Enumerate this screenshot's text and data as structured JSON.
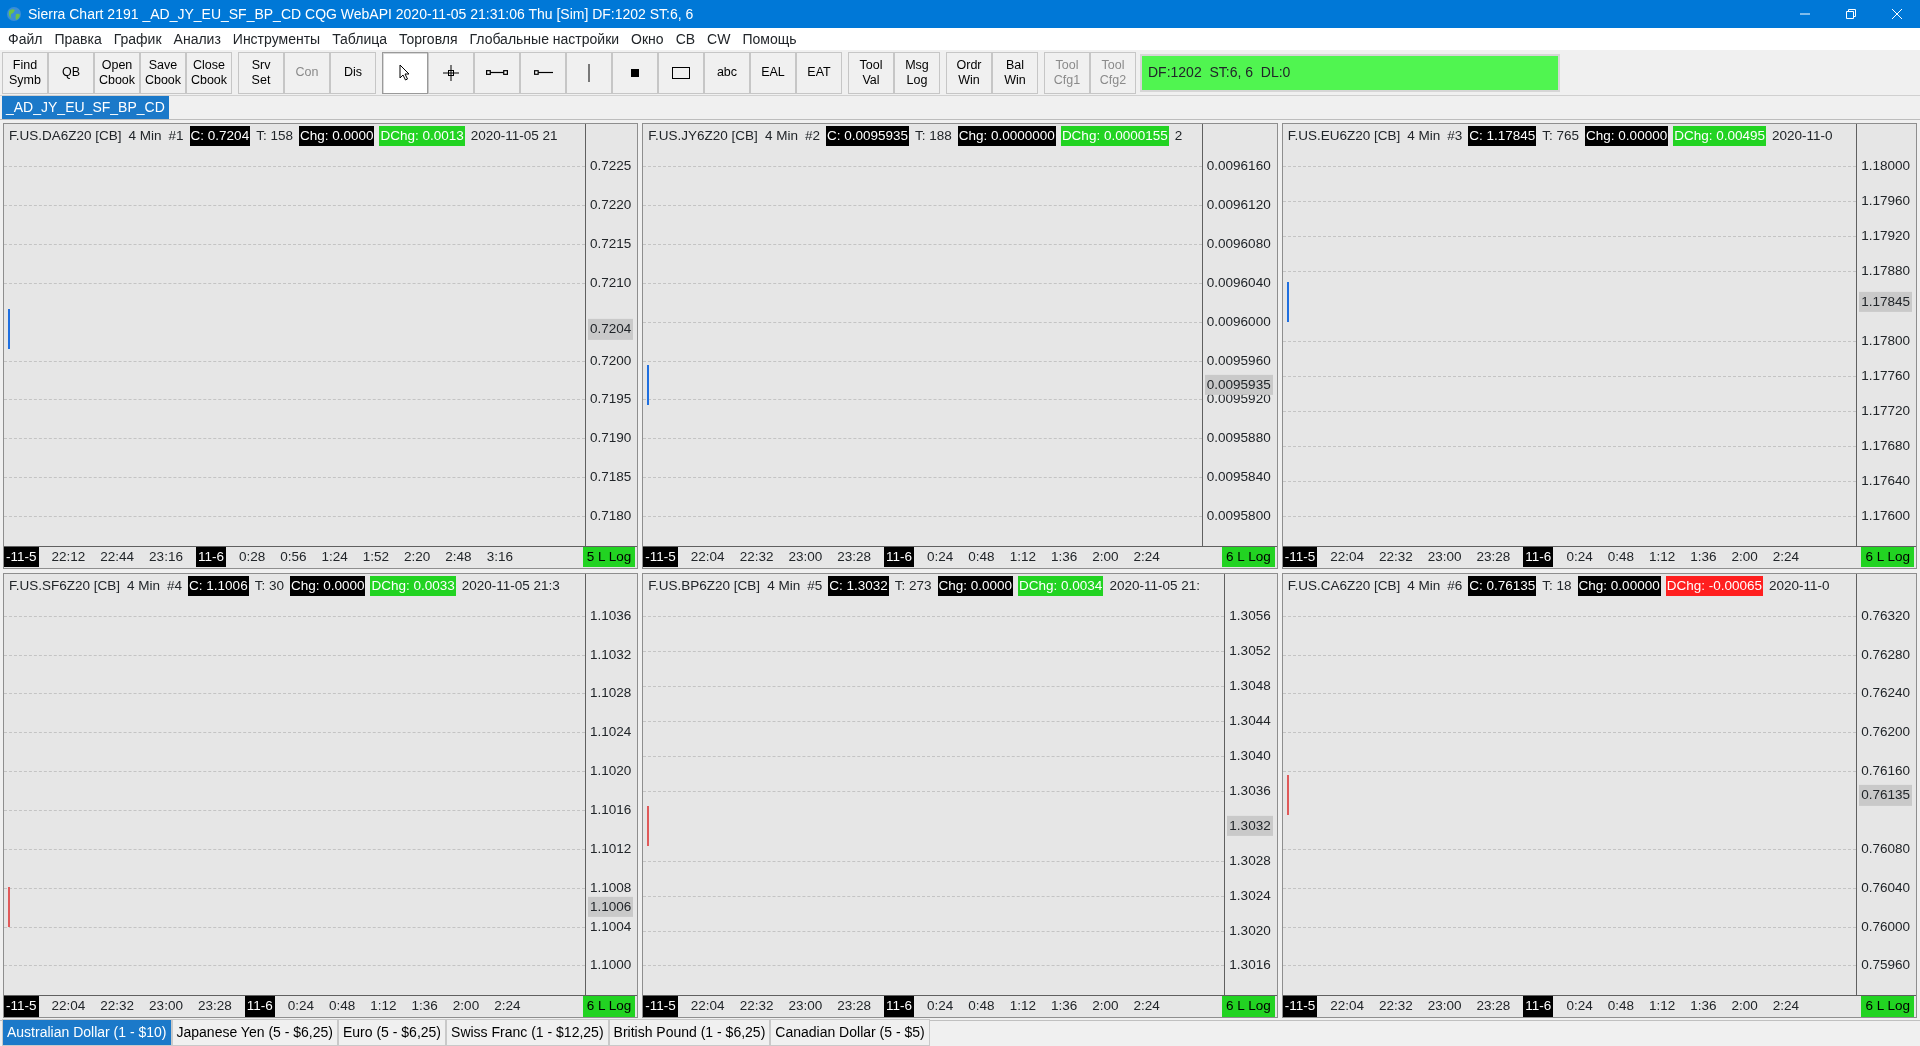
{
  "window": {
    "title": "Sierra Chart 2191 _AD_JY_EU_SF_BP_CD  CQG WebAPI 2020-11-05  21:31:06 Thu [Sim]  DF:1202  ST:6, 6"
  },
  "menu": [
    "Файл",
    "Правка",
    "График",
    "Анализ",
    "Инструменты",
    "Таблица",
    "Торговля",
    "Глобальные настройки",
    "Окно",
    "CB",
    "CW",
    "Помощь"
  ],
  "toolbar": [
    {
      "kind": "text",
      "lines": [
        "Find",
        "Symb"
      ],
      "disabled": false
    },
    {
      "kind": "text",
      "lines": [
        "QB"
      ],
      "disabled": false
    },
    {
      "kind": "text",
      "lines": [
        "Open",
        "Cbook"
      ],
      "disabled": false
    },
    {
      "kind": "text",
      "lines": [
        "Save",
        "Cbook"
      ],
      "disabled": false
    },
    {
      "kind": "text",
      "lines": [
        "Close",
        "Cbook"
      ],
      "disabled": false
    },
    {
      "kind": "text",
      "lines": [
        "Srv",
        "Set"
      ],
      "disabled": false,
      "group_start": true
    },
    {
      "kind": "text",
      "lines": [
        "Con"
      ],
      "disabled": true
    },
    {
      "kind": "text",
      "lines": [
        "Dis"
      ],
      "disabled": false
    },
    {
      "kind": "tool",
      "selected": true,
      "group_start": true
    },
    {
      "kind": "tool",
      "selected": false
    },
    {
      "kind": "tool",
      "selected": false
    },
    {
      "kind": "tool",
      "selected": false
    },
    {
      "kind": "tool",
      "selected": false
    },
    {
      "kind": "tool",
      "selected": false
    },
    {
      "kind": "tool",
      "selected": false
    },
    {
      "kind": "text",
      "lines": [
        "abc"
      ],
      "disabled": false
    },
    {
      "kind": "text",
      "lines": [
        "EAL"
      ],
      "disabled": false
    },
    {
      "kind": "text",
      "lines": [
        "EAT"
      ],
      "disabled": false
    },
    {
      "kind": "text",
      "lines": [
        "Tool",
        "Val"
      ],
      "disabled": false,
      "group_start": true
    },
    {
      "kind": "text",
      "lines": [
        "Msg",
        "Log"
      ],
      "disabled": false
    },
    {
      "kind": "text",
      "lines": [
        "Ordr",
        "Win"
      ],
      "disabled": false,
      "group_start": true
    },
    {
      "kind": "text",
      "lines": [
        "Bal",
        "Win"
      ],
      "disabled": false
    },
    {
      "kind": "text",
      "lines": [
        "Tool",
        "Cfg1"
      ],
      "disabled": true,
      "group_start": true
    },
    {
      "kind": "text",
      "lines": [
        "Tool",
        "Cfg2"
      ],
      "disabled": true
    }
  ],
  "status": "DF:1202  ST:6, 6  DL:0",
  "chartbook_tabs": [
    {
      "label": "_AD_JY_EU_SF_BP_CD",
      "selected": true
    }
  ],
  "charts": [
    {
      "color": "#1f6fe0",
      "header": [
        {
          "kind": "text",
          "text": "F.US.DA6Z20 [CB]"
        },
        {
          "kind": "text",
          "text": "4 Min"
        },
        {
          "kind": "text",
          "text": "#1"
        },
        {
          "kind": "dark",
          "text": "C: 0.7204"
        },
        {
          "kind": "text",
          "text": "T: 158"
        },
        {
          "kind": "dark",
          "text": "Chg: 0.0000"
        },
        {
          "kind": "green",
          "text": "DChg: 0.0013"
        },
        {
          "kind": "text",
          "text": "2020-11-05 21"
        }
      ],
      "price_labels": [
        "0.7225",
        "0.7220",
        "0.7215",
        "0.7210",
        "0.7200",
        "0.7195",
        "0.7190",
        "0.7185",
        "0.7180"
      ],
      "current_price": "0.7204",
      "time_labels": [
        {
          "kind": "date",
          "text": "-11-5"
        },
        {
          "kind": "time",
          "text": "22:12"
        },
        {
          "kind": "time",
          "text": "22:44"
        },
        {
          "kind": "time",
          "text": "23:16"
        },
        {
          "kind": "date",
          "text": "11-6"
        },
        {
          "kind": "time",
          "text": "0:28"
        },
        {
          "kind": "time",
          "text": "0:56"
        },
        {
          "kind": "time",
          "text": "1:24"
        },
        {
          "kind": "time",
          "text": "1:52"
        },
        {
          "kind": "time",
          "text": "2:20"
        },
        {
          "kind": "time",
          "text": "2:48"
        },
        {
          "kind": "time",
          "text": "3:16"
        }
      ],
      "scale": "5 L Log"
    },
    {
      "color": "#1f6fe0",
      "header": [
        {
          "kind": "text",
          "text": "F.US.JY6Z20 [CB]"
        },
        {
          "kind": "text",
          "text": "4 Min"
        },
        {
          "kind": "text",
          "text": "#2"
        },
        {
          "kind": "dark",
          "text": "C: 0.0095935"
        },
        {
          "kind": "text",
          "text": "T: 188"
        },
        {
          "kind": "dark",
          "text": "Chg: 0.0000000"
        },
        {
          "kind": "green",
          "text": "DChg: 0.0000155"
        },
        {
          "kind": "text",
          "text": "2"
        }
      ],
      "price_labels": [
        "0.0096160",
        "0.0096120",
        "0.0096080",
        "0.0096040",
        "0.0096000",
        "0.0095960",
        "0.0095920",
        "0.0095880",
        "0.0095840",
        "0.0095800"
      ],
      "current_price": "0.0095935",
      "time_labels": [
        {
          "kind": "date",
          "text": "-11-5"
        },
        {
          "kind": "time",
          "text": "22:04"
        },
        {
          "kind": "time",
          "text": "22:32"
        },
        {
          "kind": "time",
          "text": "23:00"
        },
        {
          "kind": "time",
          "text": "23:28"
        },
        {
          "kind": "date",
          "text": "11-6"
        },
        {
          "kind": "time",
          "text": "0:24"
        },
        {
          "kind": "time",
          "text": "0:48"
        },
        {
          "kind": "time",
          "text": "1:12"
        },
        {
          "kind": "time",
          "text": "1:36"
        },
        {
          "kind": "time",
          "text": "2:00"
        },
        {
          "kind": "time",
          "text": "2:24"
        }
      ],
      "scale": "6 L Log"
    },
    {
      "color": "#1f6fe0",
      "header": [
        {
          "kind": "text",
          "text": "F.US.EU6Z20 [CB]"
        },
        {
          "kind": "text",
          "text": "4 Min"
        },
        {
          "kind": "text",
          "text": "#3"
        },
        {
          "kind": "dark",
          "text": "C: 1.17845"
        },
        {
          "kind": "text",
          "text": "T: 765"
        },
        {
          "kind": "dark",
          "text": "Chg: 0.00000"
        },
        {
          "kind": "green",
          "text": "DChg: 0.00495"
        },
        {
          "kind": "text",
          "text": "2020-11-0"
        }
      ],
      "price_labels": [
        "1.18000",
        "1.17960",
        "1.17920",
        "1.17880",
        "1.17800",
        "1.17760",
        "1.17720",
        "1.17680",
        "1.17640",
        "1.17600"
      ],
      "current_price": "1.17845",
      "time_labels": [
        {
          "kind": "date",
          "text": "-11-5"
        },
        {
          "kind": "time",
          "text": "22:04"
        },
        {
          "kind": "time",
          "text": "22:32"
        },
        {
          "kind": "time",
          "text": "23:00"
        },
        {
          "kind": "time",
          "text": "23:28"
        },
        {
          "kind": "date",
          "text": "11-6"
        },
        {
          "kind": "time",
          "text": "0:24"
        },
        {
          "kind": "time",
          "text": "0:48"
        },
        {
          "kind": "time",
          "text": "1:12"
        },
        {
          "kind": "time",
          "text": "1:36"
        },
        {
          "kind": "time",
          "text": "2:00"
        },
        {
          "kind": "time",
          "text": "2:24"
        }
      ],
      "scale": "6 L Log"
    },
    {
      "color": "#e05a5a",
      "header": [
        {
          "kind": "text",
          "text": "F.US.SF6Z20 [CB]"
        },
        {
          "kind": "text",
          "text": "4 Min"
        },
        {
          "kind": "text",
          "text": "#4"
        },
        {
          "kind": "dark",
          "text": "C: 1.1006"
        },
        {
          "kind": "text",
          "text": "T: 30"
        },
        {
          "kind": "dark",
          "text": "Chg: 0.0000"
        },
        {
          "kind": "green",
          "text": "DChg: 0.0033"
        },
        {
          "kind": "text",
          "text": "2020-11-05 21:3"
        }
      ],
      "price_labels": [
        "1.1036",
        "1.1032",
        "1.1028",
        "1.1024",
        "1.1020",
        "1.1016",
        "1.1012",
        "1.1008",
        "1.1004",
        "1.1000"
      ],
      "current_price": "1.1006",
      "time_labels": [
        {
          "kind": "date",
          "text": "-11-5"
        },
        {
          "kind": "time",
          "text": "22:04"
        },
        {
          "kind": "time",
          "text": "22:32"
        },
        {
          "kind": "time",
          "text": "23:00"
        },
        {
          "kind": "time",
          "text": "23:28"
        },
        {
          "kind": "date",
          "text": "11-6"
        },
        {
          "kind": "time",
          "text": "0:24"
        },
        {
          "kind": "time",
          "text": "0:48"
        },
        {
          "kind": "time",
          "text": "1:12"
        },
        {
          "kind": "time",
          "text": "1:36"
        },
        {
          "kind": "time",
          "text": "2:00"
        },
        {
          "kind": "time",
          "text": "2:24"
        }
      ],
      "scale": "6 L Log"
    },
    {
      "color": "#e05a5a",
      "header": [
        {
          "kind": "text",
          "text": "F.US.BP6Z20 [CB]"
        },
        {
          "kind": "text",
          "text": "4 Min"
        },
        {
          "kind": "text",
          "text": "#5"
        },
        {
          "kind": "dark",
          "text": "C: 1.3032"
        },
        {
          "kind": "text",
          "text": "T: 273"
        },
        {
          "kind": "dark",
          "text": "Chg: 0.0000"
        },
        {
          "kind": "green",
          "text": "DChg: 0.0034"
        },
        {
          "kind": "text",
          "text": "2020-11-05 21:"
        }
      ],
      "price_labels": [
        "1.3056",
        "1.3052",
        "1.3048",
        "1.3044",
        "1.3040",
        "1.3036",
        "1.3028",
        "1.3024",
        "1.3020",
        "1.3016"
      ],
      "current_price": "1.3032",
      "time_labels": [
        {
          "kind": "date",
          "text": "-11-5"
        },
        {
          "kind": "time",
          "text": "22:04"
        },
        {
          "kind": "time",
          "text": "22:32"
        },
        {
          "kind": "time",
          "text": "23:00"
        },
        {
          "kind": "time",
          "text": "23:28"
        },
        {
          "kind": "date",
          "text": "11-6"
        },
        {
          "kind": "time",
          "text": "0:24"
        },
        {
          "kind": "time",
          "text": "0:48"
        },
        {
          "kind": "time",
          "text": "1:12"
        },
        {
          "kind": "time",
          "text": "1:36"
        },
        {
          "kind": "time",
          "text": "2:00"
        },
        {
          "kind": "time",
          "text": "2:24"
        }
      ],
      "scale": "6 L Log"
    },
    {
      "color": "#e05a5a",
      "header": [
        {
          "kind": "text",
          "text": "F.US.CA6Z20 [CB]"
        },
        {
          "kind": "text",
          "text": "4 Min"
        },
        {
          "kind": "text",
          "text": "#6"
        },
        {
          "kind": "dark",
          "text": "C: 0.76135"
        },
        {
          "kind": "text",
          "text": "T: 18"
        },
        {
          "kind": "dark",
          "text": "Chg: 0.00000"
        },
        {
          "kind": "red",
          "text": "DChg: -0.00065"
        },
        {
          "kind": "text",
          "text": "2020-11-0"
        }
      ],
      "price_labels": [
        "0.76320",
        "0.76280",
        "0.76240",
        "0.76200",
        "0.76160",
        "0.76080",
        "0.76040",
        "0.76000",
        "0.75960"
      ],
      "current_price": "0.76135",
      "time_labels": [
        {
          "kind": "date",
          "text": "-11-5"
        },
        {
          "kind": "time",
          "text": "22:04"
        },
        {
          "kind": "time",
          "text": "22:32"
        },
        {
          "kind": "time",
          "text": "23:00"
        },
        {
          "kind": "time",
          "text": "23:28"
        },
        {
          "kind": "date",
          "text": "11-6"
        },
        {
          "kind": "time",
          "text": "0:24"
        },
        {
          "kind": "time",
          "text": "0:48"
        },
        {
          "kind": "time",
          "text": "1:12"
        },
        {
          "kind": "time",
          "text": "1:36"
        },
        {
          "kind": "time",
          "text": "2:00"
        },
        {
          "kind": "time",
          "text": "2:24"
        }
      ],
      "scale": "6 L Log"
    }
  ],
  "chart_tabs": [
    {
      "label": "Australian Dollar (1 - $10)",
      "selected": true
    },
    {
      "label": "Japanese Yen (5 - $6,25)",
      "selected": false
    },
    {
      "label": "Euro (5 - $6,25)",
      "selected": false
    },
    {
      "label": "Swiss Franc (1 - $12,25)",
      "selected": false
    },
    {
      "label": "British Pound (1 - $6,25)",
      "selected": false
    },
    {
      "label": "Canadian Dollar (5 - $5)",
      "selected": false
    }
  ]
}
